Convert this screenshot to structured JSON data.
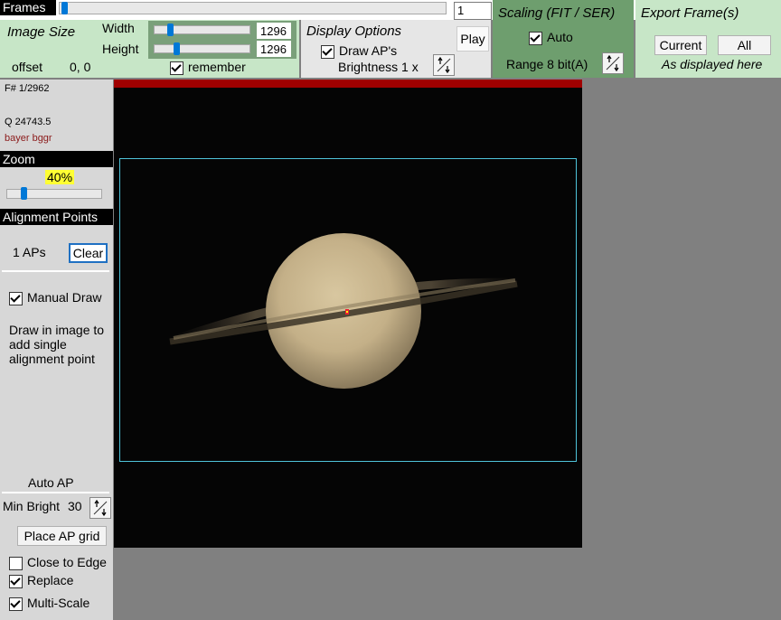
{
  "top": {
    "frames_label": "Frames",
    "frame_slider_value": 0.0,
    "frame_input": "1"
  },
  "image_size": {
    "title": "Image Size",
    "width_label": "Width",
    "height_label": "Height",
    "width_value": "1296",
    "height_value": "1296",
    "offset_label": "offset",
    "offset_value": "0, 0",
    "remember_label": "remember",
    "remember_checked": true
  },
  "display_options": {
    "title": "Display Options",
    "draw_aps_label": "Draw AP's",
    "draw_aps_checked": true,
    "brightness_label": "Brightness 1 x",
    "play_label": "Play"
  },
  "scaling": {
    "title": "Scaling (FIT / SER)",
    "auto_label": "Auto",
    "auto_checked": true,
    "range_label": "Range 8 bit(A)"
  },
  "export": {
    "title": "Export Frame(s)",
    "current_label": "Current",
    "all_label": "All",
    "note": "As displayed here"
  },
  "sidebar": {
    "frame_counter": "F# 1/2962",
    "quality": "Q  24743.5",
    "bayer": "bayer bggr",
    "zoom_header": "Zoom",
    "zoom_value": "40%",
    "ap_header": "Alignment Points",
    "ap_count": "1 APs",
    "clear_label": "Clear",
    "manual_draw_label": "Manual Draw",
    "manual_draw_checked": true,
    "draw_help": "Draw in image to add single alignment point",
    "auto_ap_title": "Auto AP",
    "min_bright_label": "Min Bright",
    "min_bright_value": "30",
    "place_grid_label": "Place AP grid",
    "close_to_edge_label": "Close to Edge",
    "close_to_edge_checked": false,
    "replace_label": "Replace",
    "replace_checked": true,
    "multi_scale_label": "Multi-Scale",
    "multi_scale_checked": true
  },
  "colors": {
    "panel_light_green": "#c7e6c7",
    "panel_dark_green": "#6e9e6e",
    "roi_border": "#4fc3d9",
    "planet": "#c9b58f"
  }
}
